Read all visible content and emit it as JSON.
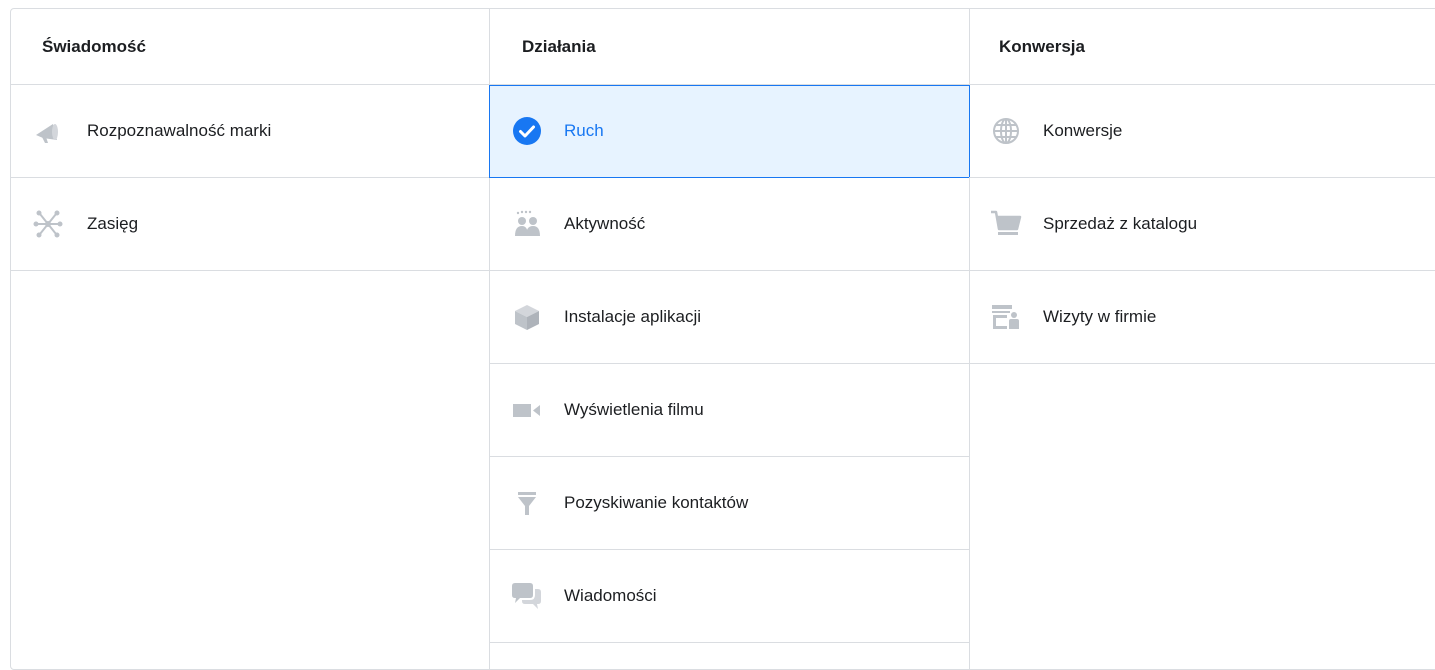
{
  "columns": [
    {
      "title": "Świadomość",
      "items": [
        {
          "label": "Rozpoznawalność marki",
          "icon": "megaphone-icon"
        },
        {
          "label": "Zasięg",
          "icon": "network-icon"
        }
      ]
    },
    {
      "title": "Działania",
      "items": [
        {
          "label": "Ruch",
          "icon": "check-circle-icon",
          "selected": true
        },
        {
          "label": "Aktywność",
          "icon": "people-icon"
        },
        {
          "label": "Instalacje aplikacji",
          "icon": "box-icon"
        },
        {
          "label": "Wyświetlenia filmu",
          "icon": "video-camera-icon"
        },
        {
          "label": "Pozyskiwanie kontaktów",
          "icon": "funnel-icon"
        },
        {
          "label": "Wiadomości",
          "icon": "chat-bubbles-icon"
        }
      ]
    },
    {
      "title": "Konwersja",
      "items": [
        {
          "label": "Konwersje",
          "icon": "globe-icon"
        },
        {
          "label": "Sprzedaż z katalogu",
          "icon": "cart-icon"
        },
        {
          "label": "Wizyty w firmie",
          "icon": "store-visit-icon"
        }
      ]
    }
  ],
  "colors": {
    "icon_gray": "#bec3c9",
    "selected_blue": "#1877f2",
    "selected_bg": "#e7f3ff",
    "border": "#dadde1"
  }
}
